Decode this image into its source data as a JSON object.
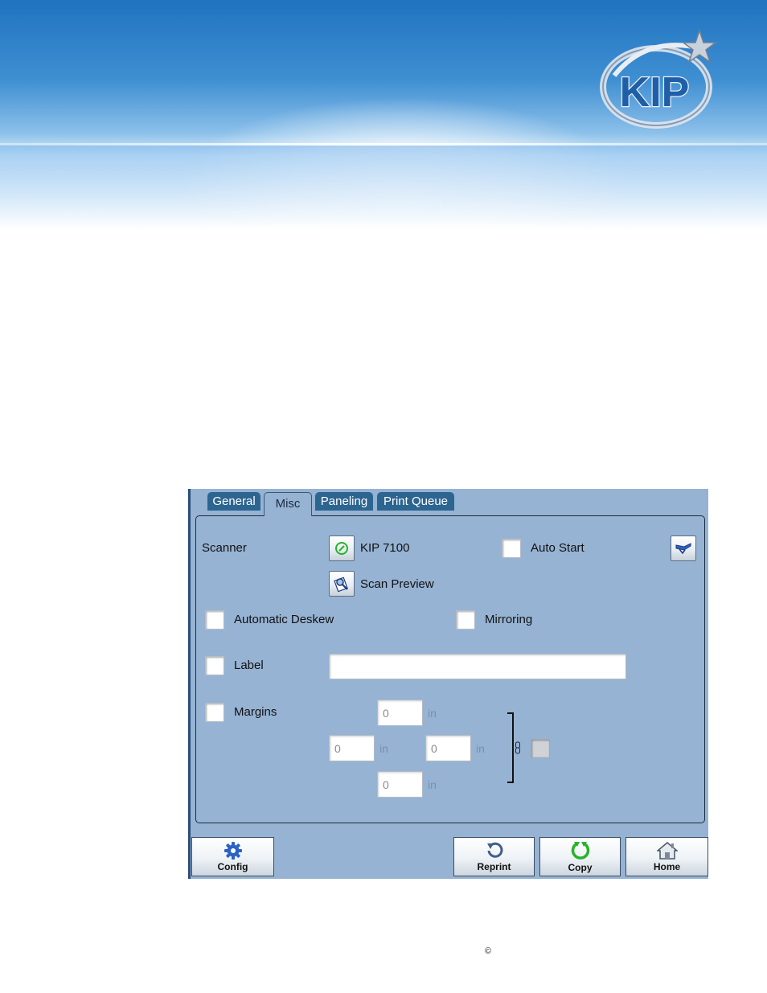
{
  "colors": {
    "tab_bg": "#2d6591",
    "panel_bg": "#96b3d3",
    "accent_green": "#27b327",
    "icon_blue": "#2d62c5"
  },
  "brand": {
    "logo_text": "KIP"
  },
  "tabs": [
    {
      "label": "General",
      "active": false
    },
    {
      "label": "Misc",
      "active": true
    },
    {
      "label": "Paneling",
      "active": false
    },
    {
      "label": "Print Queue",
      "active": false
    }
  ],
  "scanner": {
    "label": "Scanner",
    "device_button_icon": "power-green-icon",
    "device_name": "KIP 7100",
    "auto_start_label": "Auto Start",
    "auto_start_checked": false,
    "scan_tool_icon": "scanner-icon",
    "preview_icon": "scan-preview-icon",
    "preview_label": "Scan Preview"
  },
  "options": {
    "deskew_label": "Automatic Deskew",
    "deskew_checked": false,
    "mirroring_label": "Mirroring",
    "mirroring_checked": false,
    "label_label": "Label",
    "label_checked": false,
    "label_value": ""
  },
  "margins": {
    "label": "Margins",
    "checked": false,
    "top": "0",
    "left": "0",
    "right": "0",
    "bottom": "0",
    "unit": "in",
    "link_checked": false
  },
  "footer": {
    "config_label": "Config",
    "config_icon": "gear-icon",
    "reprint_label": "Reprint",
    "reprint_icon": "reprint-arrow-icon",
    "copy_label": "Copy",
    "copy_icon": "copy-cycle-icon",
    "home_label": "Home",
    "home_icon": "home-icon"
  },
  "copyright_symbol": "©"
}
